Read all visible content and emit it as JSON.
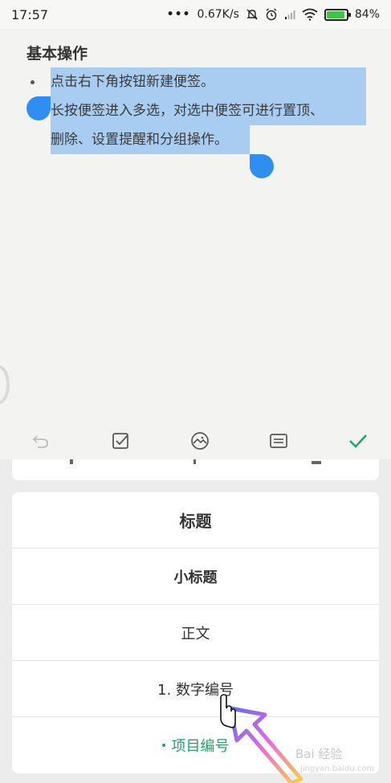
{
  "status_bar": {
    "time": "17:57",
    "dots": "•••",
    "network_speed": "0.67K/s",
    "battery_percent": "84%",
    "battery_level": 0.84,
    "icons": [
      "mute-bell-icon",
      "alarm-icon",
      "signal-icon",
      "wifi-icon",
      "battery-icon"
    ]
  },
  "note": {
    "title": "基本操作",
    "lines": [
      "点击右下角按钮新建便签。",
      "长按便签进入多选，对选中便签可进行置顶、",
      "删除、设置提醒和分组操作。"
    ],
    "selection_color": "#a9cdf0",
    "handle_color": "#2f8ff0"
  },
  "toolbar": {
    "icons": [
      "undo-icon",
      "checklist-icon",
      "image-icon",
      "format-icon",
      "done-check-icon"
    ],
    "accent": "#1fa36b"
  },
  "format_menu": {
    "items": [
      {
        "label": "标题"
      },
      {
        "label": "小标题"
      },
      {
        "label": "正文"
      },
      {
        "label": "1. 数字编号"
      },
      {
        "label": "项目编号"
      }
    ],
    "active_color": "#1fa36b"
  },
  "watermark": {
    "text": "Bai 经验",
    "url": "jingyan.baidu.com"
  }
}
